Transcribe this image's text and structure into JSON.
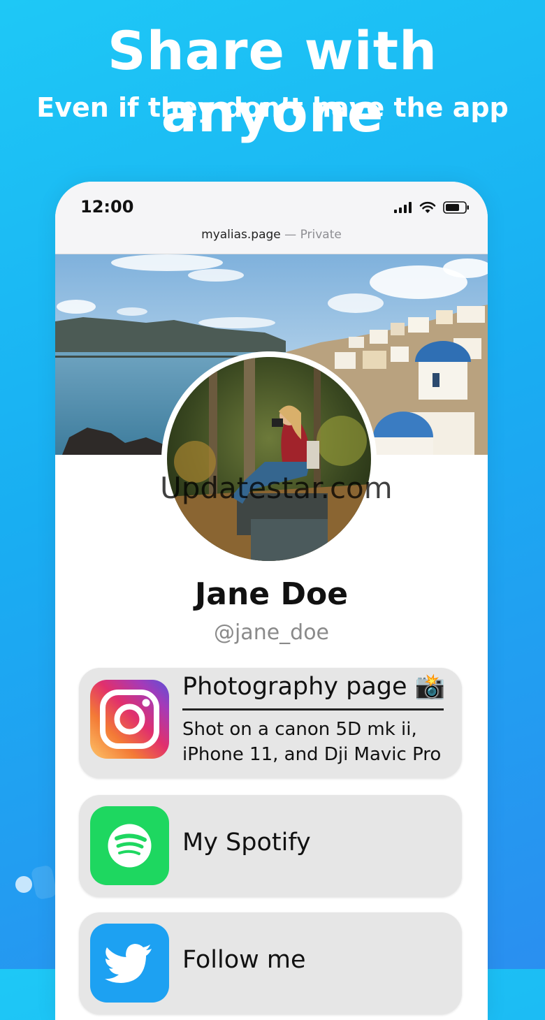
{
  "headline": "Share with anyone",
  "subheadline": "Even if they don’t have the app",
  "status_bar": {
    "time": "12:00",
    "icons": [
      "signal-icon",
      "wifi-icon",
      "battery-icon"
    ]
  },
  "browser": {
    "domain": "myalias.page",
    "separator": " — ",
    "visibility": "Private"
  },
  "profile": {
    "name": "Jane Doe",
    "handle": "@jane_doe"
  },
  "watermark": "Updatestar.com",
  "links": [
    {
      "icon": "instagram-icon",
      "title": "Photography page 📸",
      "description": "Shot on a canon 5D mk ii, iPhone 11, and Dji Mavic Pro"
    },
    {
      "icon": "spotify-icon",
      "title": "My Spotify"
    },
    {
      "icon": "twitter-icon",
      "title": "Follow me"
    }
  ],
  "colors": {
    "background_start": "#1ec8f6",
    "background_end": "#2a8ff0",
    "spotify_green": "#1ed760",
    "twitter_blue": "#1da1f2"
  }
}
